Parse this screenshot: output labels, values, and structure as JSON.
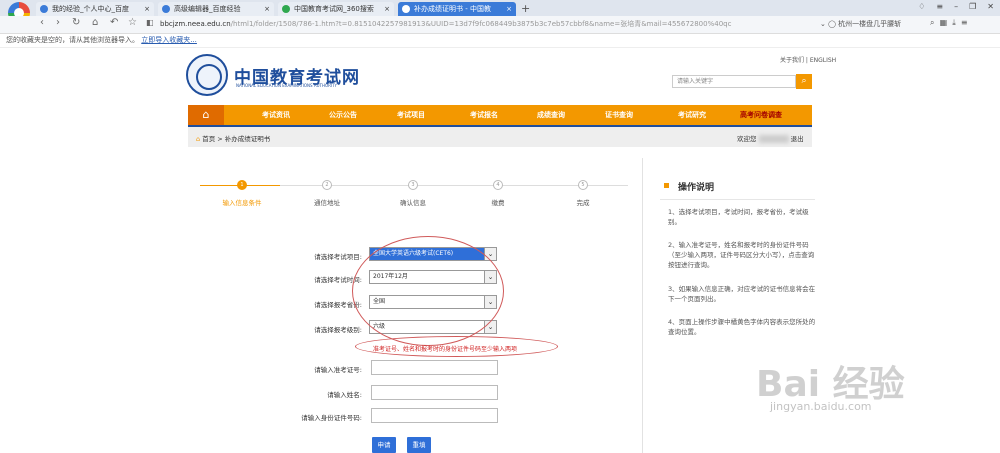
{
  "browser": {
    "tabs": [
      {
        "label": "我的经验_个人中心_百度",
        "close": "×",
        "active": false,
        "icon_color": "#3b7bd8"
      },
      {
        "label": "高级编辑器_百度经验",
        "close": "×",
        "active": false,
        "icon_color": "#3b7bd8"
      },
      {
        "label": "中国教育考试网_360搜索",
        "close": "×",
        "active": false,
        "icon_color": "#2fa84f"
      },
      {
        "label": "补办成绩证明书 - 中国教",
        "close": "×",
        "active": true,
        "icon_color": "#ffffff"
      }
    ],
    "new_tab": "+",
    "url_prefix": "bbcjzm.neea.edu.cn",
    "url_rest": "/html1/folder/1508/786-1.htm?t=0.8151042257981913&UUID=13d7f9fc068449b3875b3c7eb57cbbf8&name=张培青&mail=455672800%40qc",
    "search_ext": "杭州一楼盘几乎腰斩",
    "favorites_text": "您的收藏夹是空的，请从其他浏览器导入。",
    "favorites_link": "立即导入收藏夹..."
  },
  "site": {
    "title": "中国教育考试网",
    "subtitle": "NATIONAL EDUCATION EXAMINATIONS AUTHORITY",
    "top_links": "关于我们 | ENGLISH",
    "search_placeholder": "请输入关键字",
    "nav": [
      "考试资讯",
      "公示公告",
      "考试项目",
      "考试报名",
      "成绩查询",
      "证书查询",
      "考试研究",
      "高考问卷调查"
    ],
    "breadcrumb": "首页 > 补办成绩证明书",
    "welcome": "欢迎您",
    "logout": "退出"
  },
  "steps": [
    {
      "num": "1",
      "label": "输入信息条件",
      "active": true
    },
    {
      "num": "2",
      "label": "通信地址",
      "active": false
    },
    {
      "num": "3",
      "label": "确认信息",
      "active": false
    },
    {
      "num": "4",
      "label": "缴费",
      "active": false
    },
    {
      "num": "5",
      "label": "完成",
      "active": false
    }
  ],
  "form": {
    "fields": [
      {
        "label": "请选择考试项目:",
        "value": "全国大学英语六级考试(CET6)",
        "type": "select",
        "highlighted": true
      },
      {
        "label": "请选择考试时间:",
        "value": "2017年12月",
        "type": "select",
        "highlighted": false
      },
      {
        "label": "请选择报考省份:",
        "value": "全国",
        "type": "select",
        "highlighted": false
      },
      {
        "label": "请选择报考级别:",
        "value": "六级",
        "type": "select",
        "highlighted": false
      }
    ],
    "note": "准考证号、姓名和报考时的身份证件号码至少输入两项",
    "inputs": [
      {
        "label": "请输入准考证号:",
        "value": ""
      },
      {
        "label": "请输入姓名:",
        "value": ""
      },
      {
        "label": "请输入身份证件号码:",
        "value": ""
      }
    ],
    "submit": "申请",
    "reset": "重填"
  },
  "instructions": {
    "title": "操作说明",
    "items": [
      "1、选择考试项目，考试时间，报考省份，考试级别。",
      "2、输入准考证号，姓名和报考时的身份证件号码（至少输入两项，证件号码区分大小写），点击查询按钮进行查询。",
      "3、如果输入信息正确，对应考试的证书信息将会在下一个页面列出。",
      "4、页面上操作步骤中橘黄色字体内容表示您所处的查询位置。"
    ]
  },
  "watermark": {
    "brand": "Bai 经验",
    "url": "jingyan.baidu.com"
  },
  "colors": {
    "accent": "#f39800",
    "brand_blue": "#1f4e9c",
    "annotation_red": "#d05a5a"
  }
}
